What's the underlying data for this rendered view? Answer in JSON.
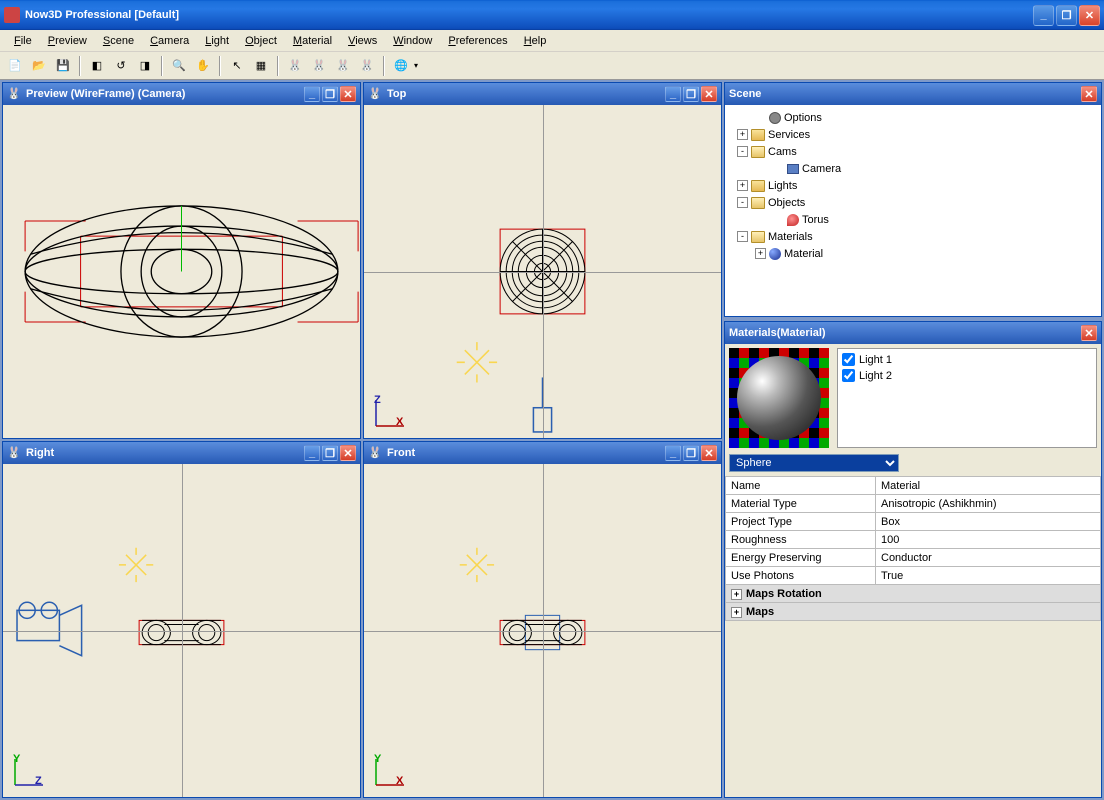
{
  "titlebar": {
    "app_name": "Now3D Professional",
    "doc_name": "[Default]"
  },
  "menus": [
    "File",
    "Preview",
    "Scene",
    "Camera",
    "Light",
    "Object",
    "Material",
    "Views",
    "Window",
    "Preferences",
    "Help"
  ],
  "toolbar": [
    "new",
    "open",
    "save",
    "|",
    "copy",
    "undo",
    "paste",
    "|",
    "zoom",
    "pan",
    "|",
    "pointer",
    "grid",
    "|",
    "rabbit1",
    "rabbit2",
    "rabbit3",
    "rabbit4",
    "|",
    "ie"
  ],
  "viewports": {
    "tl": {
      "title": "Preview (WireFrame) (Camera)"
    },
    "tr": {
      "title": "Top"
    },
    "bl": {
      "title": "Right"
    },
    "br": {
      "title": "Front"
    }
  },
  "scene_panel": {
    "title": "Scene",
    "tree": [
      {
        "indent": 1,
        "exp": "",
        "icon": "gear",
        "label": "Options"
      },
      {
        "indent": 0,
        "exp": "+",
        "icon": "folder",
        "label": "Services"
      },
      {
        "indent": 0,
        "exp": "-",
        "icon": "folder-open",
        "label": "Cams"
      },
      {
        "indent": 2,
        "exp": "",
        "icon": "camera",
        "label": "Camera"
      },
      {
        "indent": 0,
        "exp": "+",
        "icon": "folder",
        "label": "Lights"
      },
      {
        "indent": 0,
        "exp": "-",
        "icon": "folder-open",
        "label": "Objects"
      },
      {
        "indent": 2,
        "exp": "",
        "icon": "shape",
        "label": "Torus"
      },
      {
        "indent": 0,
        "exp": "-",
        "icon": "folder-open",
        "label": "Materials"
      },
      {
        "indent": 1,
        "exp": "+",
        "icon": "ball",
        "label": "Material"
      }
    ]
  },
  "materials_panel": {
    "title": "Materials(Material)",
    "lights": [
      "Light 1",
      "Light 2"
    ],
    "preview_select": "Sphere",
    "props": [
      {
        "key": "Name",
        "val": "Material"
      },
      {
        "key": "Material Type",
        "val": "Anisotropic (Ashikhmin)"
      },
      {
        "key": "Project Type",
        "val": "Box"
      },
      {
        "key": "Roughness",
        "val": "100"
      },
      {
        "key": "Energy Preserving",
        "val": "Conductor"
      },
      {
        "key": "Use Photons",
        "val": "True"
      }
    ],
    "groups": [
      "Maps Rotation",
      "Maps"
    ]
  },
  "axes": {
    "x": "X",
    "y": "Y",
    "z": "Z"
  }
}
